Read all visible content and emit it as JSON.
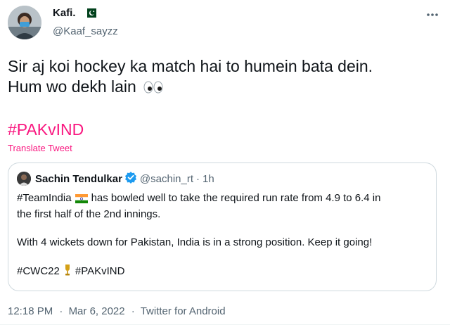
{
  "tweet": {
    "author_name": "Kafi.",
    "author_handle": "@Kaaf_sayzz",
    "text_line1": "Sir aj koi hockey ka match hai to humein bata dein.",
    "text_line2": "Hum wo dekh lain",
    "hashtag": "#PAKvIND",
    "translate_label": "Translate Tweet",
    "time": "12:18 PM",
    "date": "Mar 6, 2022",
    "source": "Twitter for Android"
  },
  "quoted": {
    "author_name": "Sachin Tendulkar",
    "author_handle": "@sachin_rt",
    "time": "1h",
    "line1_tag": "#TeamIndia",
    "line1_text": "has bowled well to take the required run rate from 4.9 to 6.4 in",
    "line2_text": "the first half of the 2nd innings.",
    "para2": "With 4 wickets down for Pakistan, India is in a strong position. Keep it going!",
    "tag1": "#CWC22",
    "tag2": "#PAKvIND"
  },
  "icons": {
    "flag": "pakistan-flag-icon",
    "eyes": "eyes-emoji-icon",
    "verified": "verified-badge-icon",
    "india_flag": "india-flag-icon",
    "trophy": "trophy-icon",
    "more": "more-options-icon"
  },
  "colors": {
    "accent": "#f91880",
    "text": "#0f1419",
    "muted": "#536471",
    "border": "#cfd9de",
    "verified": "#1d9bf0"
  }
}
